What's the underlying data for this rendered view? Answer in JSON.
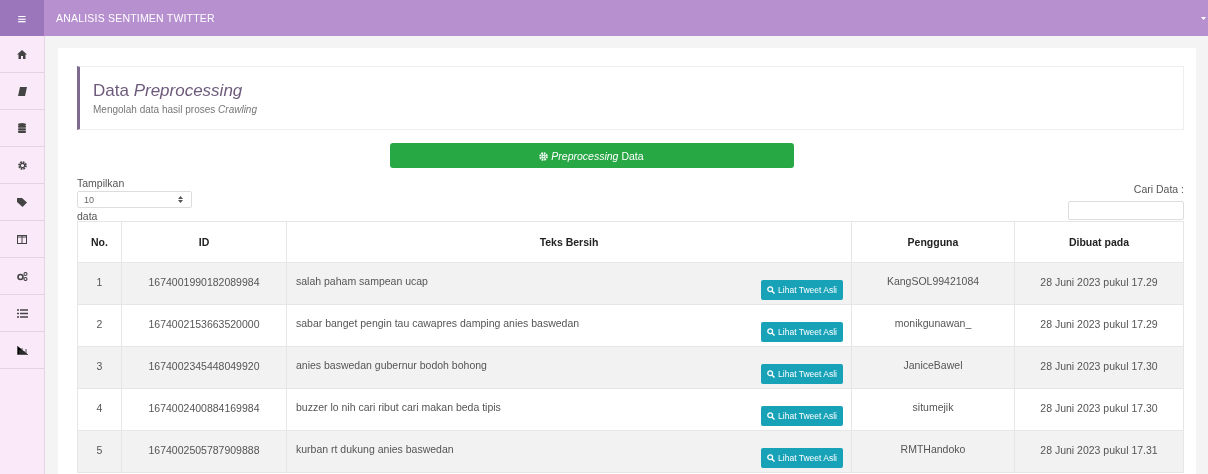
{
  "topbar": {
    "menu_icon": "≡",
    "title": "ANALISIS SENTIMEN TWITTER"
  },
  "sidebar": {
    "items": [
      {
        "kind": "home"
      },
      {
        "kind": "book"
      },
      {
        "kind": "database"
      },
      {
        "kind": "gear"
      },
      {
        "kind": "tags"
      },
      {
        "kind": "columns"
      },
      {
        "kind": "cogs"
      },
      {
        "kind": "list"
      },
      {
        "kind": "chart"
      }
    ]
  },
  "header": {
    "title": "Data *Preprocessing*",
    "subtitle": "Mengolah data hasil proses *Crawling*"
  },
  "action_button": {
    "label": "*Preprocessing* Data"
  },
  "length_control": {
    "label_before": "Tampilkan",
    "value": "10",
    "label_after": "data"
  },
  "search": {
    "label": "Cari Data :"
  },
  "table": {
    "columns": [
      "No.",
      "ID",
      "Teks Bersih",
      "Pengguna",
      "Dibuat pada"
    ],
    "rows": [
      {
        "no": "1",
        "id": "1674001990182089984",
        "text": "salah paham sampean ucap",
        "button": "Lihat Tweet Asli",
        "user": "KangSOL99421084",
        "created": "28 Juni 2023 pukul 17.29"
      },
      {
        "no": "2",
        "id": "1674002153663520000",
        "text": "sabar banget pengin tau cawapres damping anies baswedan",
        "button": "Lihat Tweet Asli",
        "user": "monikgunawan_",
        "created": "28 Juni 2023 pukul 17.29"
      },
      {
        "no": "3",
        "id": "1674002345448049920",
        "text": "anies baswedan gubernur bodoh bohong",
        "button": "Lihat Tweet Asli",
        "user": "JaniceBawel",
        "created": "28 Juni 2023 pukul 17.30"
      },
      {
        "no": "4",
        "id": "1674002400884169984",
        "text": "buzzer lo nih cari ribut cari makan beda tipis",
        "button": "Lihat Tweet Asli",
        "user": "situmejik",
        "created": "28 Juni 2023 pukul 17.30"
      },
      {
        "no": "5",
        "id": "1674002505787909888",
        "text": "kurban rt dukung anies baswedan",
        "button": "Lihat Tweet Asli",
        "user": "RMTHandoko",
        "created": "28 Juni 2023 pukul 17.31"
      }
    ]
  }
}
